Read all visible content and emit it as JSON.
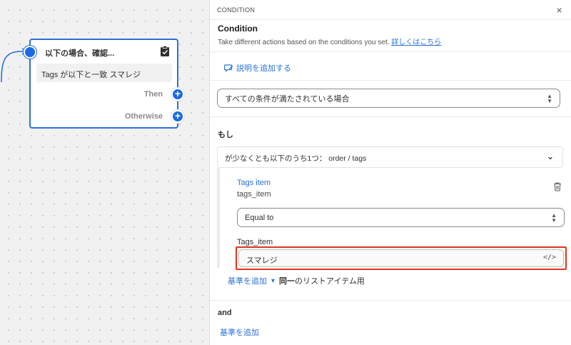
{
  "node": {
    "title": "以下の場合、確認...",
    "summary": "Tags が以下と一致 スマレジ",
    "then_label": "Then",
    "otherwise_label": "Otherwise",
    "accent_color": "#1b6ae3"
  },
  "panel": {
    "header": "CONDITION",
    "close": "×",
    "title": "Condition",
    "subtitle": "Take different actions based on the conditions you set.",
    "learn_more": "詳しくはこちら",
    "add_description": "説明を追加する",
    "match_select": "すべての条件が満たされている場合",
    "if_label": "もし",
    "accordion": "が少なくとも以下のうち1つ： order / tags",
    "item_title": "Tags item",
    "item_sub": "tags_item",
    "operator": "Equal to",
    "field_label": "Tags_item",
    "field_value": "スマレジ",
    "code_icon": "</>",
    "add_criteria": "基準を追加",
    "same_prefix": "同一",
    "same_suffix": "のリストアイテム用",
    "and_label": "and",
    "add_criteria_2": "基準を追加",
    "link_color": "#2b71d6",
    "highlight_color": "#e0341c"
  }
}
